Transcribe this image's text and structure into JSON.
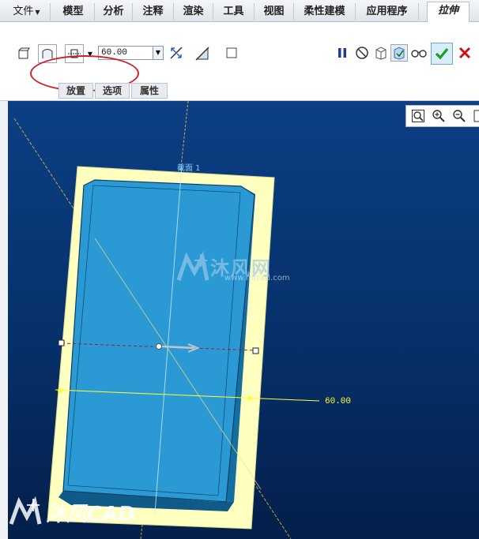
{
  "menu": {
    "file": "文件",
    "items": [
      "模型",
      "分析",
      "注释",
      "渲染",
      "工具",
      "视图",
      "柔性建模",
      "应用程序"
    ],
    "active_tab": "拉伸"
  },
  "extrude": {
    "depth_value": "60.00",
    "sub_tabs": [
      "放置",
      "选项",
      "属性"
    ]
  },
  "viewport": {
    "section_label": "截面 1",
    "dimension_label": "60.00"
  },
  "watermark": {
    "center_text": "沐风网",
    "center_url": "www.mfcad.com",
    "corner_text": "沐风CAD"
  },
  "colors": {
    "callout": "#d0202a",
    "sketch_plane": "#ffffc0",
    "part_body": "#2b9ad4",
    "background_top": "#0c3f84",
    "dimension": "#ffff33",
    "confirm": "#1aa01a",
    "cancel": "#d01010"
  }
}
